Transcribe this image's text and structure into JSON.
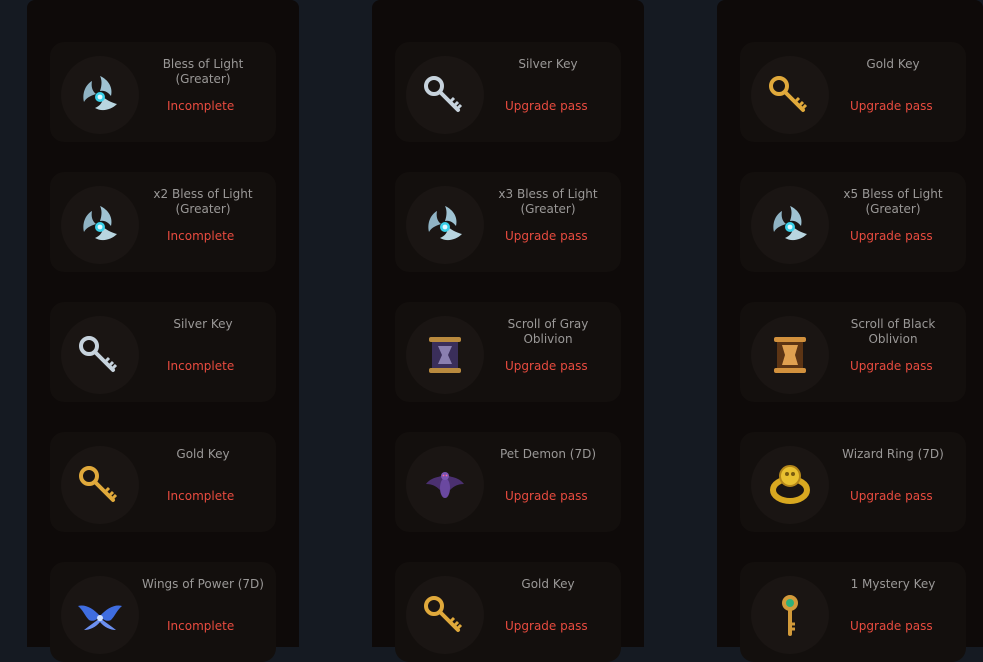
{
  "columns": [
    {
      "cards": [
        {
          "name": "Bless of Light (Greater)",
          "status": "Incomplete",
          "icon": "bless-of-light-icon"
        },
        {
          "name": "x2 Bless of Light (Greater)",
          "status": "Incomplete",
          "icon": "bless-of-light-icon"
        },
        {
          "name": "Silver Key",
          "status": "Incomplete",
          "icon": "silver-key-icon"
        },
        {
          "name": "Gold Key",
          "status": "Incomplete",
          "icon": "gold-key-icon"
        },
        {
          "name": "Wings of Power (7D)",
          "status": "Incomplete",
          "icon": "wings-icon"
        }
      ]
    },
    {
      "cards": [
        {
          "name": "Silver Key",
          "status": "Upgrade pass",
          "icon": "silver-key-icon"
        },
        {
          "name": "x3 Bless of Light (Greater)",
          "status": "Upgrade pass",
          "icon": "bless-of-light-icon"
        },
        {
          "name": "Scroll of Gray Oblivion",
          "status": "Upgrade pass",
          "icon": "scroll-gray-icon"
        },
        {
          "name": "Pet Demon (7D)",
          "status": "Upgrade pass",
          "icon": "pet-demon-icon"
        },
        {
          "name": "Gold Key",
          "status": "Upgrade pass",
          "icon": "gold-key-icon"
        }
      ]
    },
    {
      "cards": [
        {
          "name": "Gold Key",
          "status": "Upgrade pass",
          "icon": "gold-key-icon"
        },
        {
          "name": "x5 Bless of Light (Greater)",
          "status": "Upgrade pass",
          "icon": "bless-of-light-icon"
        },
        {
          "name": "Scroll of Black Oblivion",
          "status": "Upgrade pass",
          "icon": "scroll-black-icon"
        },
        {
          "name": "Wizard Ring (7D)",
          "status": "Upgrade pass",
          "icon": "wizard-ring-icon"
        },
        {
          "name": "1 Mystery Key",
          "status": "Upgrade pass",
          "icon": "mystery-key-icon"
        }
      ]
    }
  ],
  "colors": {
    "status": "#e84b3f",
    "name_text": "#9a9897",
    "page_bg": "#151a22",
    "column_bg": "#0e0a09",
    "card_bg": "#130f0d"
  }
}
